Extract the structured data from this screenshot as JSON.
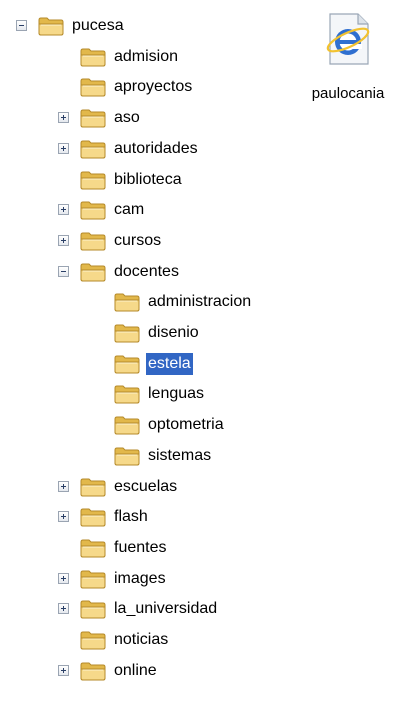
{
  "tree": {
    "items": [
      {
        "label": "pucesa",
        "level": 0,
        "expander": "minus",
        "selected": false
      },
      {
        "label": "admision",
        "level": 1,
        "expander": null,
        "selected": false
      },
      {
        "label": "aproyectos",
        "level": 1,
        "expander": null,
        "selected": false
      },
      {
        "label": "aso",
        "level": 1,
        "expander": "plus",
        "selected": false
      },
      {
        "label": "autoridades",
        "level": 1,
        "expander": "plus",
        "selected": false
      },
      {
        "label": "biblioteca",
        "level": 1,
        "expander": null,
        "selected": false
      },
      {
        "label": "cam",
        "level": 1,
        "expander": "plus",
        "selected": false
      },
      {
        "label": "cursos",
        "level": 1,
        "expander": "plus",
        "selected": false
      },
      {
        "label": "docentes",
        "level": 1,
        "expander": "minus",
        "selected": false
      },
      {
        "label": "administracion",
        "level": 2,
        "expander": null,
        "selected": false
      },
      {
        "label": "disenio",
        "level": 2,
        "expander": null,
        "selected": false
      },
      {
        "label": "estela",
        "level": 2,
        "expander": null,
        "selected": true
      },
      {
        "label": "lenguas",
        "level": 2,
        "expander": null,
        "selected": false
      },
      {
        "label": "optometria",
        "level": 2,
        "expander": null,
        "selected": false
      },
      {
        "label": "sistemas",
        "level": 2,
        "expander": null,
        "selected": false
      },
      {
        "label": "escuelas",
        "level": 1,
        "expander": "plus",
        "selected": false
      },
      {
        "label": "flash",
        "level": 1,
        "expander": "plus",
        "selected": false
      },
      {
        "label": "fuentes",
        "level": 1,
        "expander": null,
        "selected": false
      },
      {
        "label": "images",
        "level": 1,
        "expander": "plus",
        "selected": false
      },
      {
        "label": "la_universidad",
        "level": 1,
        "expander": "plus",
        "selected": false
      },
      {
        "label": "noticias",
        "level": 1,
        "expander": null,
        "selected": false
      },
      {
        "label": "online",
        "level": 1,
        "expander": "plus",
        "selected": false
      }
    ],
    "folder_icon": "folder-icon",
    "selection_color": "#3166c4"
  },
  "desktop_item": {
    "label": "paulocania",
    "icon": "internet-explorer-shortcut-icon"
  }
}
